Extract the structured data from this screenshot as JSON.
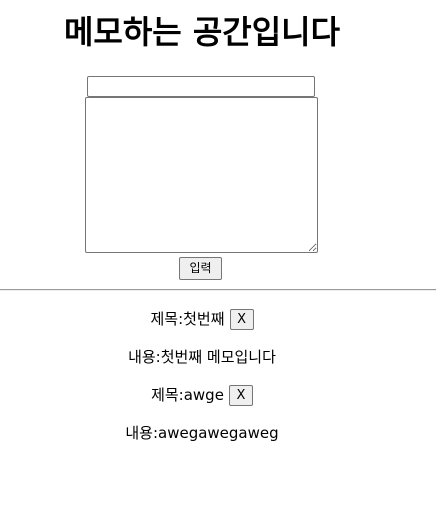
{
  "header": {
    "title": "메모하는 공간입니다"
  },
  "form": {
    "title_value": "",
    "content_value": "",
    "submit_label": "입력"
  },
  "memos": [
    {
      "title_label": "제목: ",
      "title": "첫번째",
      "delete_label": "X",
      "content_label": "내용: ",
      "content": "첫번째 메모입니다"
    },
    {
      "title_label": "제목: ",
      "title": "awge",
      "delete_label": "X",
      "content_label": "내용: ",
      "content": "awegawegaweg"
    }
  ]
}
